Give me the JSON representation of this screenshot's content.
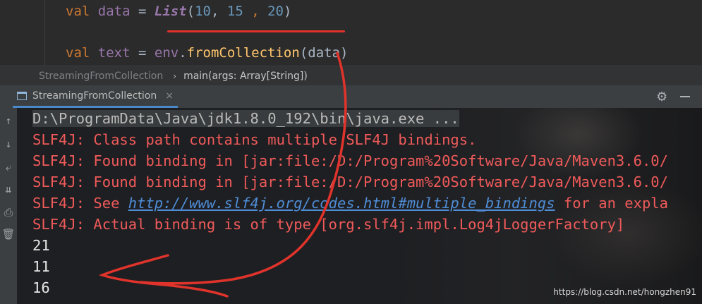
{
  "editor": {
    "line1": {
      "kw": "val",
      "name": "data",
      "eq": " = ",
      "type": "List",
      "open": "(",
      "n1": "10",
      "c1": ", ",
      "n2": "15",
      "c2": " , ",
      "n3": "20",
      "close": ")"
    },
    "line2": {
      "kw": "val",
      "name": "text",
      "eq": " = ",
      "obj": "env",
      "dot": ".",
      "fn": "fromCollection",
      "args": "(data)"
    }
  },
  "breadcrumb": {
    "file": "StreamingFromCollection",
    "separator": "›",
    "method": "main(args: Array[String])"
  },
  "run_window": {
    "tab_label": "StreamingFromCollection",
    "close": "×",
    "gear": "⚙"
  },
  "console": {
    "command": "D:\\ProgramData\\Java\\jdk1.8.0_192\\bin\\java.exe ...",
    "lines": [
      "SLF4J: Class path contains multiple SLF4J bindings.",
      "SLF4J: Found binding in [jar:file:/D:/Program%20Software/Java/Maven3.6.0/",
      "SLF4J: Found binding in [jar:file:/D:/Program%20Software/Java/Maven3.6.0/"
    ],
    "see_prefix": "SLF4J: See ",
    "see_link": "http://www.slf4j.org/codes.html#multiple_bindings",
    "see_suffix": " for an expla",
    "actual": "SLF4J: Actual binding is of type [org.slf4j.impl.Log4jLoggerFactory]",
    "outputs": [
      "21",
      "11",
      "16"
    ]
  },
  "watermark": "https://blog.csdn.net/hongzhen91",
  "colors": {
    "annotation": "#e0332b",
    "link": "#4f8dd6",
    "error_text": "#f05a5a"
  }
}
